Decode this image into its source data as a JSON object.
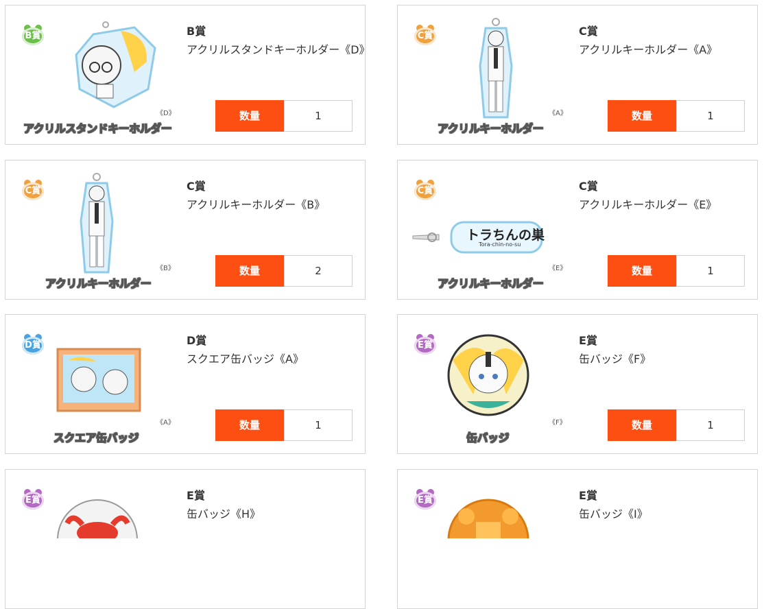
{
  "items": [
    {
      "rank": "B賞",
      "name": "アクリルスタンドキーホルダー《D》",
      "art_label": "アクリルスタンドキーホルダー",
      "variant": "《D》",
      "badge_text": "B",
      "badge_color": "#6cbf4a",
      "qty_label": "数量",
      "qty": "1"
    },
    {
      "rank": "C賞",
      "name": "アクリルキーホルダー《A》",
      "art_label": "アクリルキーホルダー",
      "variant": "《A》",
      "badge_text": "C",
      "badge_color": "#f0a03c",
      "qty_label": "数量",
      "qty": "1"
    },
    {
      "rank": "C賞",
      "name": "アクリルキーホルダー《B》",
      "art_label": "アクリルキーホルダー",
      "variant": "《B》",
      "badge_text": "C",
      "badge_color": "#f0a03c",
      "qty_label": "数量",
      "qty": "2"
    },
    {
      "rank": "C賞",
      "name": "アクリルキーホルダー《E》",
      "art_label": "アクリルキーホルダー",
      "variant": "《E》",
      "badge_text": "C",
      "badge_color": "#f0a03c",
      "qty_label": "数量",
      "qty": "1",
      "logo_text": "トラちんの巣",
      "logo_sub": "Tora-chin-no-su"
    },
    {
      "rank": "D賞",
      "name": "スクエア缶バッジ《A》",
      "art_label": "スクエア缶バッジ",
      "variant": "《A》",
      "badge_text": "D",
      "badge_color": "#4aa3df",
      "qty_label": "数量",
      "qty": "1"
    },
    {
      "rank": "E賞",
      "name": "缶バッジ《F》",
      "art_label": "缶バッジ",
      "variant": "《F》",
      "badge_text": "E",
      "badge_color": "#b36ac2",
      "qty_label": "数量",
      "qty": "1"
    },
    {
      "rank": "E賞",
      "name": "缶バッジ《H》",
      "badge_text": "E",
      "badge_color": "#b36ac2"
    },
    {
      "rank": "E賞",
      "name": "缶バッジ《I》",
      "badge_text": "E",
      "badge_color": "#b36ac2"
    }
  ]
}
